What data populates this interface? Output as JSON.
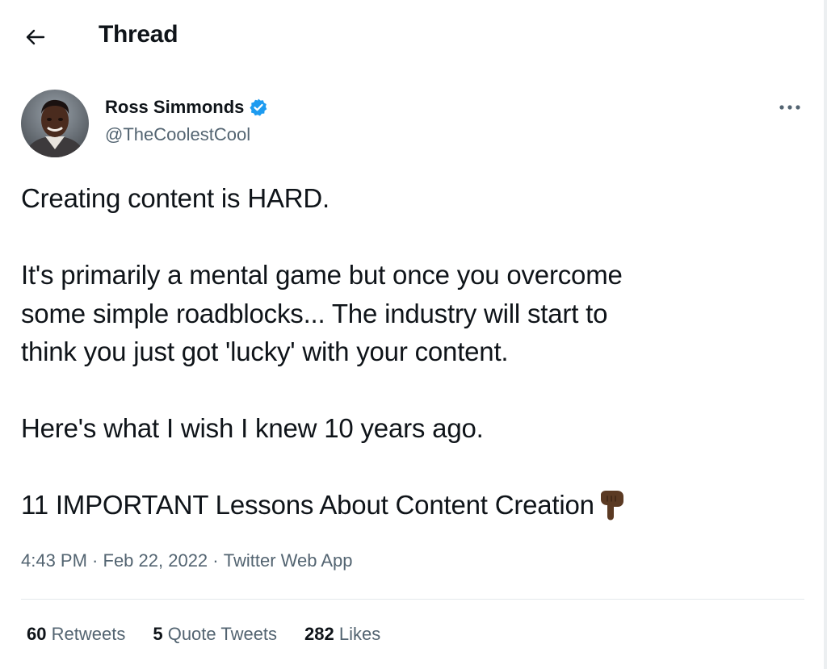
{
  "header": {
    "title": "Thread",
    "back_icon": "arrow-left-icon"
  },
  "author": {
    "name": "Ross Simmonds",
    "handle": "@TheCoolestCool",
    "verified_icon": "verified-badge-icon",
    "verified_color": "#1d9bf0"
  },
  "tweet": {
    "line1": "Creating content is HARD.",
    "para2_line1": "It's primarily a mental game but once you overcome",
    "para2_line2": "some simple roadblocks... The industry will start to",
    "para2_line3": "think you just got 'lucky' with your content.",
    "line3": "Here's what I wish I knew 10 years ago.",
    "line4": "11 IMPORTANT Lessons About Content Creation",
    "emoji": "backhand-index-pointing-down-icon"
  },
  "meta": {
    "time": "4:43 PM",
    "sep1": " · ",
    "date": "Feb 22, 2022",
    "sep2": " · ",
    "source": "Twitter Web App"
  },
  "stats": {
    "retweets_count": "60",
    "retweets_label": "Retweets",
    "quotes_count": "5",
    "quotes_label": "Quote Tweets",
    "likes_count": "282",
    "likes_label": "Likes"
  },
  "colors": {
    "text_primary": "#0f1419",
    "text_secondary": "#536471",
    "accent": "#1d9bf0",
    "divider": "#e4e8eb"
  }
}
